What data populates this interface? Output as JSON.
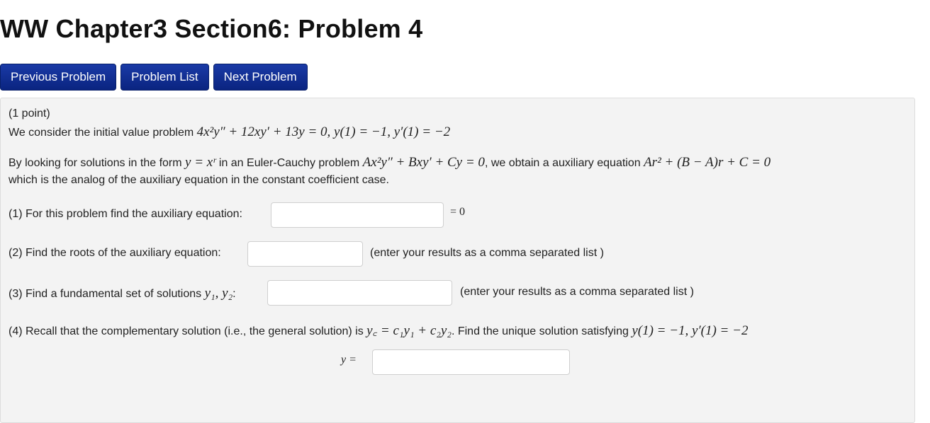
{
  "page": {
    "title": "WW Chapter3 Section6: Problem 4"
  },
  "nav": {
    "previous": "Previous Problem",
    "list": "Problem List",
    "next": "Next Problem"
  },
  "problem": {
    "points": "(1 point)",
    "intro_text": "We consider the initial value problem ",
    "ivp_equation": "4x²y″ + 12xy′ + 13y = 0,  y(1) = −1,  y′(1) = −2",
    "p2_a": "By looking for solutions in the form ",
    "p2_form": "y = xʳ",
    "p2_b": " in an Euler-Cauchy problem ",
    "p2_eq": "Ax²y″ + Bxy′ + Cy = 0",
    "p2_c": ", we obtain a auxiliary equation ",
    "p2_aux": "Ar² + (B − A)r + C = 0",
    "p2_line2": "which is the analog of the auxiliary equation in the constant coefficient case.",
    "q1_label": "(1) For this problem find the auxiliary equation:",
    "q1_value": "",
    "q1_suffix": "= 0",
    "q2_label": "(2) Find the roots of the auxiliary equation:",
    "q2_value": "",
    "q2_note": "(enter your results as a comma separated list )",
    "q3_label_a": "(3) Find a fundamental set of solutions ",
    "q3_label_math": "y₁, y₂",
    "q3_label_b": ":",
    "q3_value": "",
    "q3_note": "(enter your results as a comma separated list )",
    "q4_a": "(4) Recall that the complementary solution (i.e., the general solution) is ",
    "q4_math": "y꜀ = c₁y₁ + c₂y₂",
    "q4_b": ". Find the unique solution satisfying ",
    "q4_cond": "y(1) = −1,  y′(1) = −2",
    "q5_label": "y =",
    "q5_value": ""
  }
}
